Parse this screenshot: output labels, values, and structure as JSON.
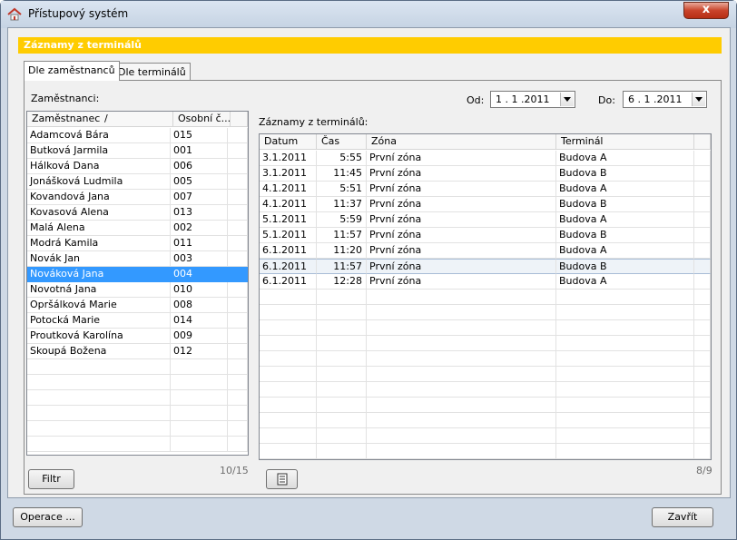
{
  "window": {
    "title": "Přístupový systém",
    "close_label": "x"
  },
  "header": {
    "title": "Záznamy z terminálů"
  },
  "tabs": [
    {
      "label": "Dle zaměstnanců",
      "active": true
    },
    {
      "label": "Dle terminálů",
      "active": false
    }
  ],
  "employees": {
    "label": "Zaměstnanci:",
    "columns": [
      "Zaměstnanec",
      "Osobní č..."
    ],
    "sort_indicator": "/",
    "rows": [
      {
        "name": "Adamcová Bára",
        "id": "015"
      },
      {
        "name": "Butková Jarmila",
        "id": "001"
      },
      {
        "name": "Hálková Dana",
        "id": "006"
      },
      {
        "name": "Jonášková Ludmila",
        "id": "005"
      },
      {
        "name": "Kovandová Jana",
        "id": "007"
      },
      {
        "name": "Kovasová Alena",
        "id": "013"
      },
      {
        "name": "Malá Alena",
        "id": "002"
      },
      {
        "name": "Modrá Kamila",
        "id": "011"
      },
      {
        "name": "Novák Jan",
        "id": "003"
      },
      {
        "name": "Nováková Jana",
        "id": "004"
      },
      {
        "name": "Novotná Jana",
        "id": "010"
      },
      {
        "name": "Opršálková Marie",
        "id": "008"
      },
      {
        "name": "Potocká Marie",
        "id": "014"
      },
      {
        "name": "Proutková Karolína",
        "id": "009"
      },
      {
        "name": "Skoupá Božena",
        "id": "012"
      }
    ],
    "selected_index": 9,
    "counter": "10/15",
    "filter_button": "Filtr"
  },
  "filter": {
    "from_label": "Od:",
    "from_value": "1 . 1 .2011",
    "to_label": "Do:",
    "to_value": "6 . 1 .2011"
  },
  "records": {
    "label": "Záznamy z terminálů:",
    "columns": [
      "Datum",
      "Čas",
      "Zóna",
      "Terminál"
    ],
    "rows": [
      {
        "date": "3.1.2011",
        "time": "5:55",
        "zone": "První zóna",
        "terminal": "Budova A"
      },
      {
        "date": "3.1.2011",
        "time": "11:45",
        "zone": "První zóna",
        "terminal": "Budova B"
      },
      {
        "date": "4.1.2011",
        "time": "5:51",
        "zone": "První zóna",
        "terminal": "Budova A"
      },
      {
        "date": "4.1.2011",
        "time": "11:37",
        "zone": "První zóna",
        "terminal": "Budova B"
      },
      {
        "date": "5.1.2011",
        "time": "5:59",
        "zone": "První zóna",
        "terminal": "Budova A"
      },
      {
        "date": "5.1.2011",
        "time": "11:57",
        "zone": "První zóna",
        "terminal": "Budova B"
      },
      {
        "date": "6.1.2011",
        "time": "11:20",
        "zone": "První zóna",
        "terminal": "Budova A"
      },
      {
        "date": "6.1.2011",
        "time": "11:57",
        "zone": "První zóna",
        "terminal": "Budova B"
      },
      {
        "date": "6.1.2011",
        "time": "12:28",
        "zone": "První zóna",
        "terminal": "Budova A"
      }
    ],
    "focused_index": 7,
    "counter": "8/9"
  },
  "footer": {
    "operations_button": "Operace ...",
    "close_button": "Zavřít"
  },
  "colors": {
    "accent": "#ffcc00",
    "selection": "#3399ff"
  }
}
